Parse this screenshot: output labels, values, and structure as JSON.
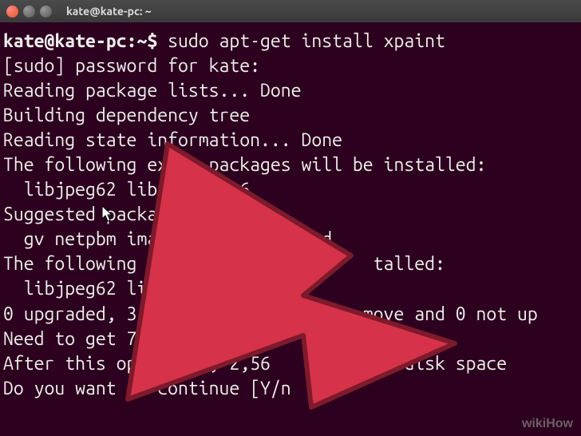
{
  "window": {
    "title": "kate@kate-pc: ~"
  },
  "terminal": {
    "prompt": "kate@kate-pc:~$",
    "command": "sudo apt-get install xpaint",
    "lines": [
      "[sudo] password for kate:",
      "Reading package lists... Done",
      "Building dependency tree",
      "Reading state information... Done",
      "The following extra packages will be installed:",
      "  libjpeg62 libxaw3dxft6",
      "Suggested packages:",
      "  gv netpbm imagemag         rad",
      "The following NEW pack              talled:",
      "  libjpeg62 libxaw3dxft",
      "0 upgraded, 3 newly inst           move and 0 not up",
      "Need to get 752 kB of arc",
      "After this operation, 2,56         nal disk space",
      "Do you want to continue [Y/n"
    ]
  },
  "watermark": "wikiHow",
  "arrow": {
    "color": "#d6324a",
    "stroke": "#7d1a2b"
  }
}
